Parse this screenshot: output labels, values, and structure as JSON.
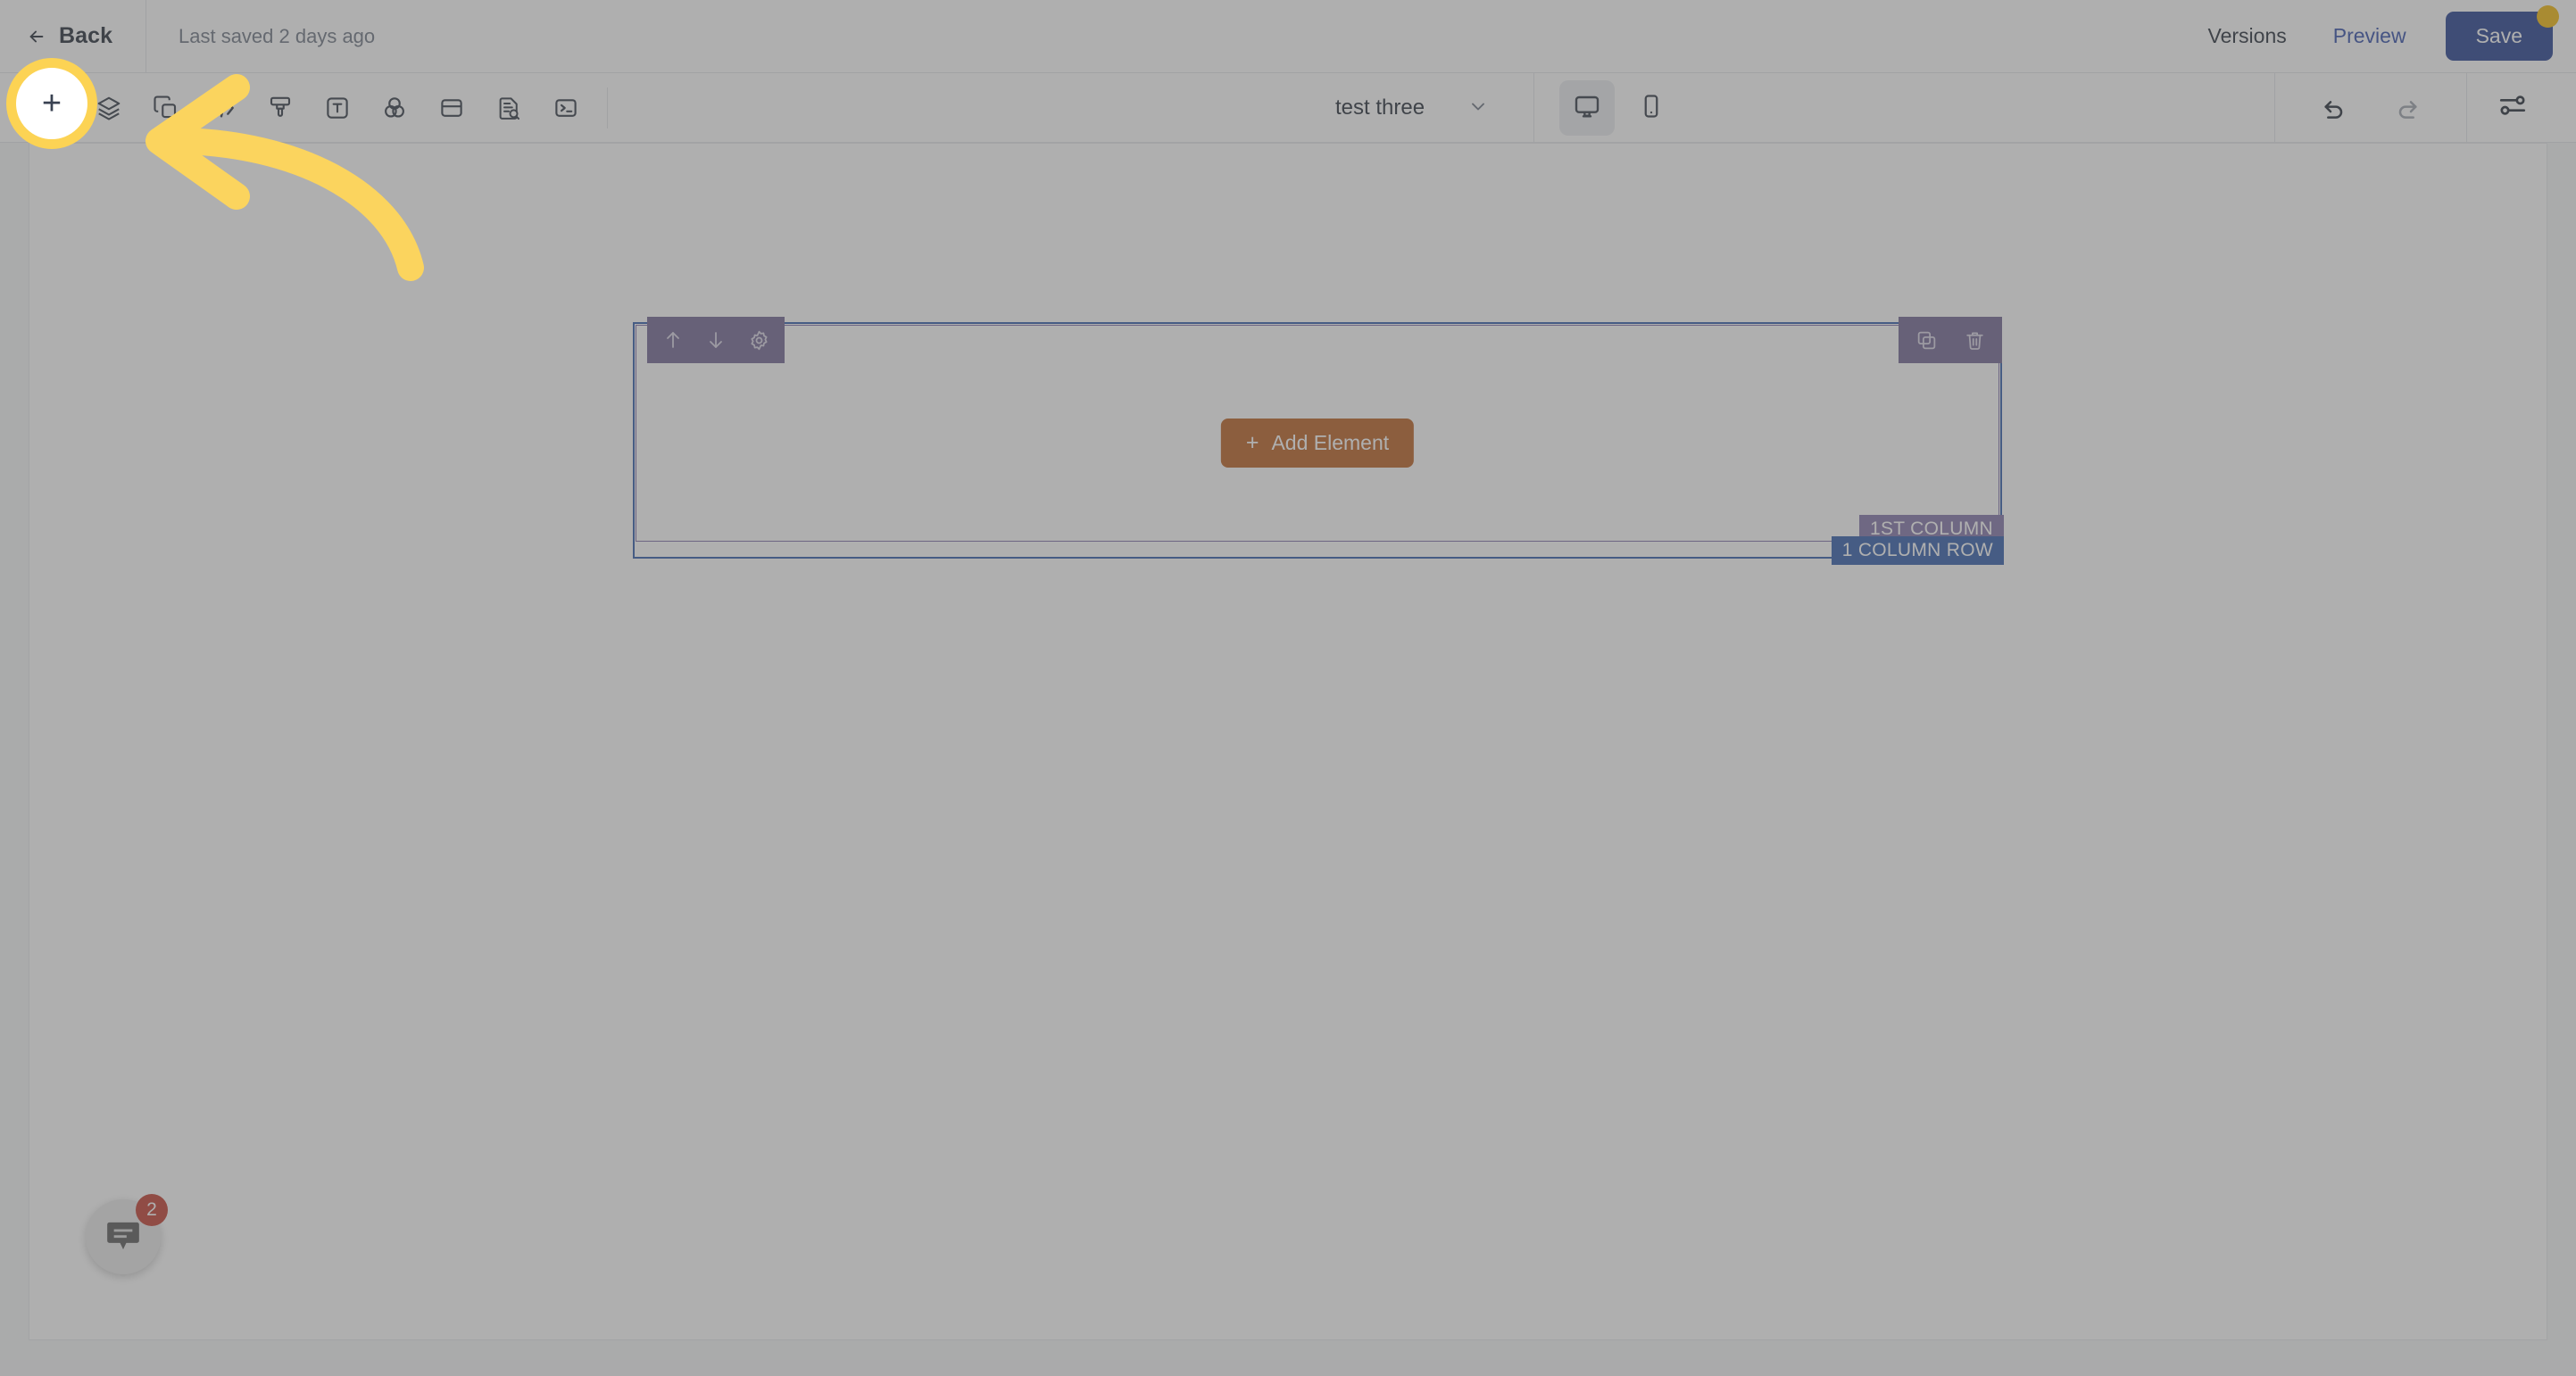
{
  "header": {
    "back_label": "Back",
    "back_icon": "arrow-left-icon",
    "last_saved": "Last saved 2 days ago",
    "versions_label": "Versions",
    "preview_label": "Preview",
    "save_label": "Save",
    "save_badge_color": "#f2b705",
    "save_button_color": "#1e3a8c",
    "preview_link_color": "#2c49a6"
  },
  "toolbar": {
    "left_tools": [
      {
        "name": "add-icon",
        "title": "Add",
        "glyph": "plus"
      },
      {
        "name": "layers-icon",
        "title": "Layers",
        "glyph": "layers"
      },
      {
        "name": "copy-icon",
        "title": "Copy",
        "glyph": "copy"
      },
      {
        "name": "code-icon",
        "title": "Code",
        "glyph": "code"
      },
      {
        "name": "brush-icon",
        "title": "Brush",
        "glyph": "brush"
      },
      {
        "name": "text-icon",
        "title": "Text",
        "glyph": "text"
      },
      {
        "name": "color-icon",
        "title": "Colors",
        "glyph": "colors"
      },
      {
        "name": "container-icon",
        "title": "Container",
        "glyph": "container"
      },
      {
        "name": "seo-icon",
        "title": "SEO",
        "glyph": "seo"
      },
      {
        "name": "terminal-icon",
        "title": "Terminal",
        "glyph": "terminal"
      }
    ],
    "page_name": "test three",
    "page_name_chevron": "chevron-down-icon",
    "viewports": [
      {
        "name": "desktop-view-button",
        "icon": "desktop-icon",
        "active": true
      },
      {
        "name": "mobile-view-button",
        "icon": "mobile-icon",
        "active": false
      }
    ],
    "undo": {
      "name": "undo-icon",
      "enabled": true
    },
    "redo": {
      "name": "redo-icon",
      "enabled": false
    },
    "settings": {
      "name": "sliders-icon",
      "enabled": true
    }
  },
  "canvas": {
    "block": {
      "row_label": "1 COLUMN ROW",
      "column_label": "1ST COLUMN",
      "row_outline_color": "#2c59a8",
      "column_outline_color": "#7b6ba6",
      "toolbar_color": "#6e6291",
      "left_tools": [
        {
          "name": "move-up-icon",
          "title": "Move up"
        },
        {
          "name": "move-down-icon",
          "title": "Move down"
        },
        {
          "name": "settings-gear-icon",
          "title": "Settings"
        }
      ],
      "right_tools": [
        {
          "name": "duplicate-icon",
          "title": "Duplicate"
        },
        {
          "name": "delete-icon",
          "title": "Delete"
        }
      ],
      "add_element_label": "Add Element",
      "add_element_plus": "+",
      "add_element_color": "#b85d1c"
    }
  },
  "chat": {
    "icon": "chat-bubble-icon",
    "badge_count": "2",
    "badge_color": "#c0392b"
  },
  "annotation": {
    "highlight_color": "#fcd354",
    "spotlight_target": "add-icon",
    "arrow": "curved-arrow-left"
  }
}
